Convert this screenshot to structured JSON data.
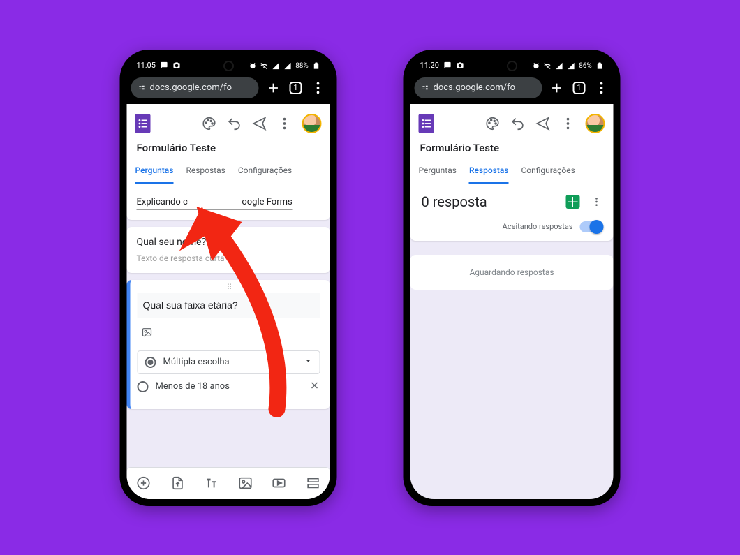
{
  "background_color": "#8a2be6",
  "phone_left": {
    "status": {
      "time": "11:05",
      "battery": "88%",
      "left_icons": [
        "message-icon",
        "camera-icon"
      ],
      "right_icons": [
        "alarm-icon",
        "wifi-mute-icon",
        "signal-icon",
        "signal-icon",
        "battery-icon"
      ]
    },
    "browser": {
      "url": "docs.google.com/fo",
      "tab_count": "1"
    },
    "forms": {
      "title": "Formulário Teste",
      "tabs": {
        "perguntas": "Perguntas",
        "respostas": "Respostas",
        "configuracoes": "Configurações"
      },
      "active_tab": "perguntas",
      "header_card_text": "Explicando como usar o Google Forms",
      "header_card_visible_parts": {
        "a": "Explicando c",
        "b": "oogle Forms"
      },
      "question1": {
        "title": "Qual seu nome?",
        "placeholder": "Texto de resposta curta"
      },
      "question2": {
        "title_underlined": "Qual",
        "title_rest": " sua faixa etária?",
        "type_label": "Múltipla escolha",
        "option1": "Menos de 18 anos"
      },
      "toolbar_icons": [
        "add-question-icon",
        "import-questions-icon",
        "add-title-icon",
        "add-image-icon",
        "add-video-icon",
        "add-section-icon"
      ]
    }
  },
  "phone_right": {
    "status": {
      "time": "11:20",
      "battery": "86%",
      "left_icons": [
        "message-icon",
        "camera-icon"
      ],
      "right_icons": [
        "alarm-icon",
        "wifi-mute-icon",
        "signal-icon",
        "signal-icon",
        "battery-icon"
      ]
    },
    "browser": {
      "url": "docs.google.com/fo",
      "tab_count": "1"
    },
    "forms": {
      "title": "Formulário Teste",
      "tabs": {
        "perguntas": "Perguntas",
        "respostas": "Respostas",
        "configuracoes": "Configurações"
      },
      "active_tab": "respostas",
      "responses_heading": "0 resposta",
      "accepting_label": "Aceitando respostas",
      "waiting_text": "Aguardando respostas"
    }
  },
  "annotation": {
    "color": "#f22613",
    "description": "red-arrow-pointing-to-respostas-tab"
  }
}
